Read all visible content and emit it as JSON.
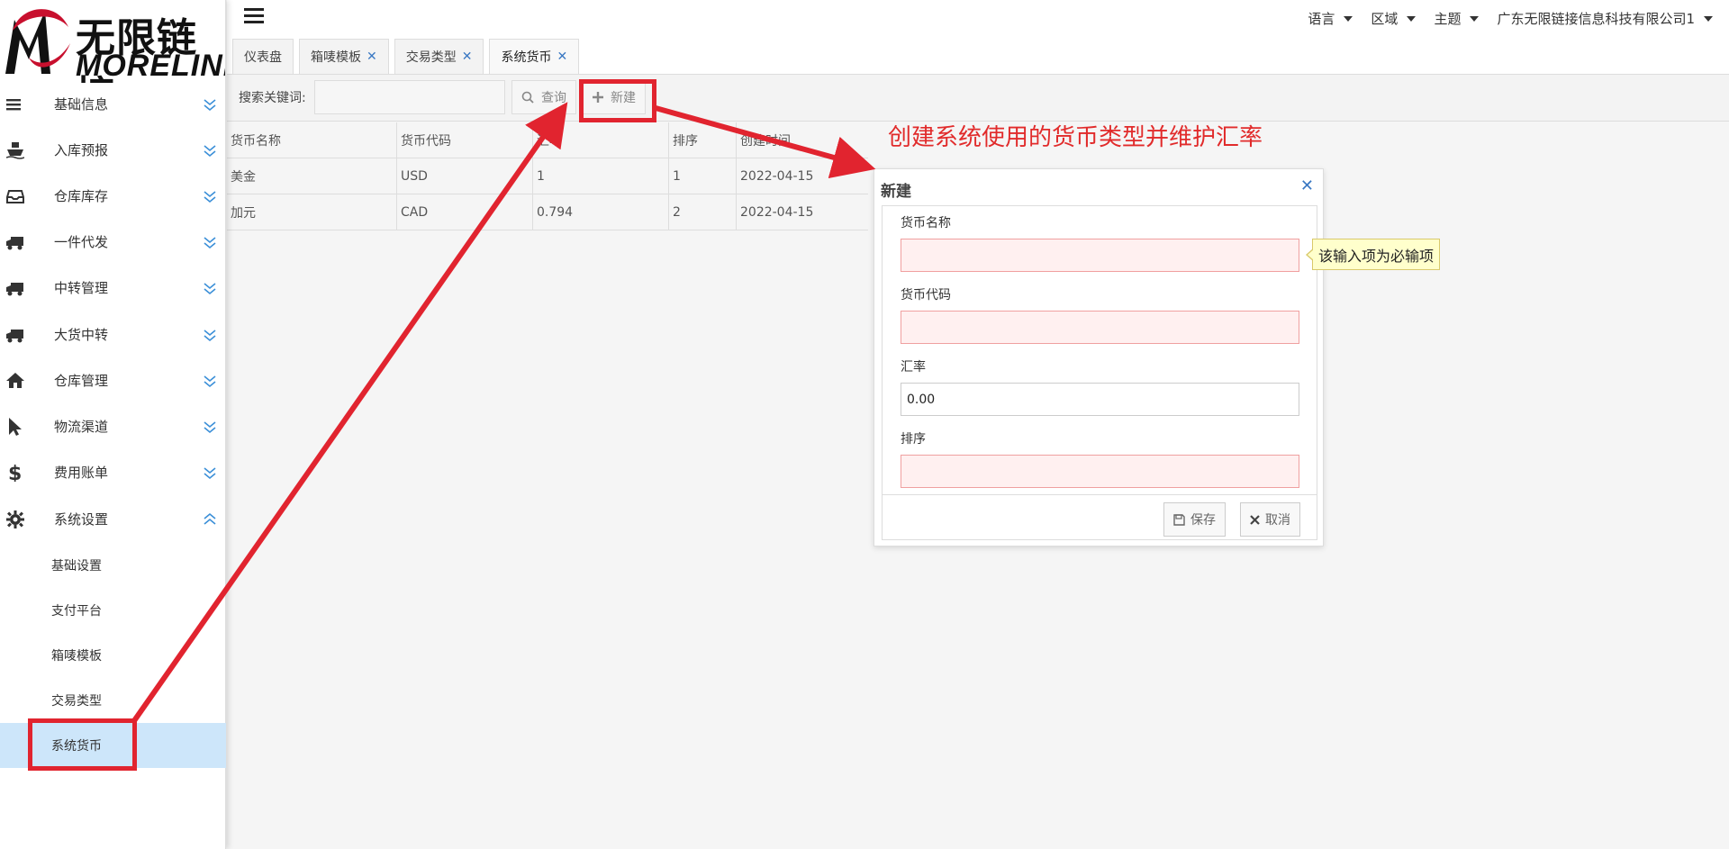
{
  "brand": {
    "cn": "无限链接",
    "en": "MORELINK",
    "accent": "#c8102e"
  },
  "sidebar": {
    "menus": [
      {
        "label": "基础信息",
        "icon": "list-icon"
      },
      {
        "label": "入库预报",
        "icon": "ship-icon"
      },
      {
        "label": "仓库库存",
        "icon": "inbox-icon"
      },
      {
        "label": "一件代发",
        "icon": "truck-icon"
      },
      {
        "label": "中转管理",
        "icon": "truck-icon"
      },
      {
        "label": "大货中转",
        "icon": "truck-icon"
      },
      {
        "label": "仓库管理",
        "icon": "home-icon"
      },
      {
        "label": "物流渠道",
        "icon": "cursor-icon"
      },
      {
        "label": "费用账单",
        "icon": "dollar-icon"
      },
      {
        "label": "系统设置",
        "icon": "gear-icon"
      }
    ],
    "subitems": [
      {
        "label": "基础设置"
      },
      {
        "label": "支付平台"
      },
      {
        "label": "箱唛模板"
      },
      {
        "label": "交易类型"
      },
      {
        "label": "系统货币",
        "active": true
      }
    ]
  },
  "header": {
    "language": "语言",
    "region": "区域",
    "theme": "主题",
    "company": "广东无限链接信息科技有限公司1"
  },
  "tabs": [
    {
      "label": "仪表盘",
      "closable": false
    },
    {
      "label": "箱唛模板",
      "closable": true
    },
    {
      "label": "交易类型",
      "closable": true
    },
    {
      "label": "系统货币",
      "closable": true,
      "active": true
    }
  ],
  "toolbar": {
    "keyword_label": "搜索关键词:",
    "search_value": "",
    "query_label": "查询",
    "new_label": "新建"
  },
  "table": {
    "columns": [
      "货币名称",
      "货币代码",
      "汇率",
      "排序",
      "创建时间"
    ],
    "rows": [
      [
        "美金",
        "USD",
        "1",
        "1",
        "2022-04-15"
      ],
      [
        "加元",
        "CAD",
        "0.794",
        "2",
        "2022-04-15"
      ]
    ]
  },
  "annotation": {
    "text": "创建系统使用的货币类型并维护汇率",
    "color": "#e12b2b"
  },
  "dialog": {
    "title": "新建",
    "fields": {
      "name_label": "货币名称",
      "name_value": "",
      "code_label": "货币代码",
      "code_value": "",
      "rate_label": "汇率",
      "rate_value": "0.00",
      "sort_label": "排序",
      "sort_value": ""
    },
    "tooltip": "该输入项为必输项",
    "save_label": "保存",
    "cancel_label": "取消"
  }
}
